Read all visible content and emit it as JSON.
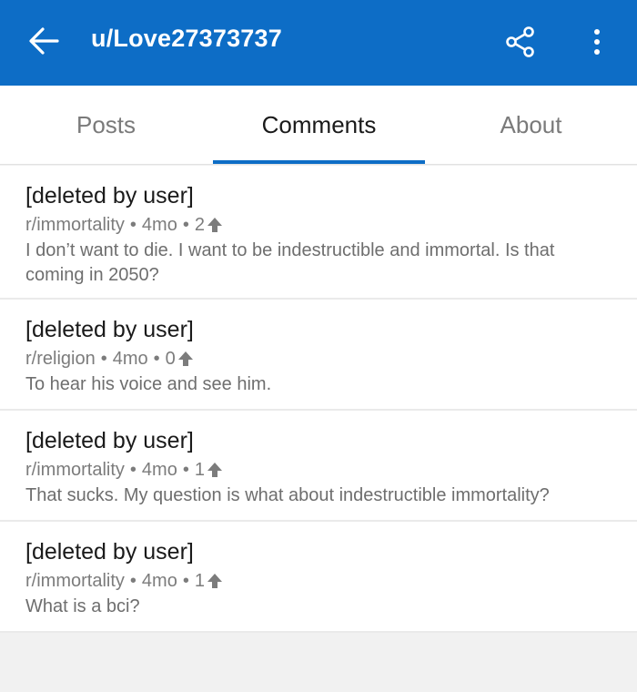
{
  "header": {
    "title": "u/Love27373737",
    "back_icon": "arrow-left-icon",
    "share_icon": "share-icon",
    "more_icon": "more-vertical-icon",
    "bg_color": "#0d6dc6"
  },
  "tabs": [
    {
      "label": "Posts",
      "active": false
    },
    {
      "label": "Comments",
      "active": true
    },
    {
      "label": "About",
      "active": false
    }
  ],
  "comments": [
    {
      "title": "[deleted by user]",
      "subreddit": "r/immortality",
      "age": "4mo",
      "score": "2",
      "body": "I don’t want to die. I want to be indestructible and immortal. Is that coming in 2050?"
    },
    {
      "title": "[deleted by user]",
      "subreddit": "r/religion",
      "age": "4mo",
      "score": "0",
      "body": "To hear his voice and see him."
    },
    {
      "title": "[deleted by user]",
      "subreddit": "r/immortality",
      "age": "4mo",
      "score": "1",
      "body": "That sucks. My question is what about indestructible immortality?"
    },
    {
      "title": "[deleted by user]",
      "subreddit": "r/immortality",
      "age": "4mo",
      "score": "1",
      "body": "What is a bci?"
    }
  ]
}
